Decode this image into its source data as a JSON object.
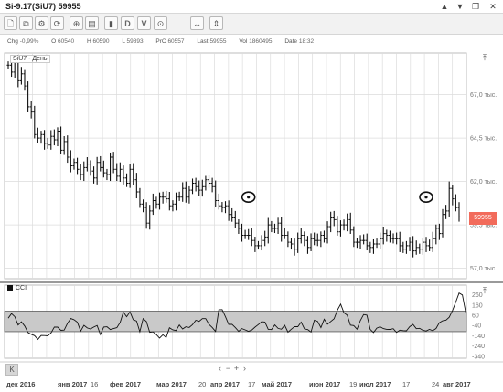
{
  "window": {
    "title": "Si-9.17(SiU7) 59955",
    "controls": [
      "▲",
      "▼",
      "❐",
      "✕"
    ]
  },
  "toolbar": {
    "buttons": [
      {
        "name": "new-doc-icon",
        "glyph": "🗋"
      },
      {
        "name": "copy-icon",
        "glyph": "⧉"
      },
      {
        "name": "gear-icon",
        "glyph": "⚙"
      },
      {
        "name": "refresh-icon",
        "glyph": "⟳"
      },
      {
        "name": "add-indicator-icon",
        "glyph": "⊕"
      },
      {
        "name": "doc-icon",
        "glyph": "▤"
      },
      {
        "name": "candles-icon",
        "glyph": "▮"
      },
      {
        "name": "d-button",
        "glyph": "D"
      },
      {
        "name": "v-button",
        "glyph": "V"
      },
      {
        "name": "target-icon",
        "glyph": "⊙"
      },
      {
        "name": "fit-horizontal-icon",
        "glyph": "↔"
      },
      {
        "name": "fit-vertical-icon",
        "glyph": "⇕"
      }
    ]
  },
  "infobar": {
    "chg_label": "Chg",
    "chg": "-0,99%",
    "open_label": "O",
    "open": "60540",
    "high_label": "H",
    "high": "60590",
    "low_label": "L",
    "low": "59893",
    "prc_label": "PrC",
    "prc": "60557",
    "last_label": "Last",
    "last": "59955",
    "vol_label": "Vol",
    "vol": "1860495",
    "date_label": "Date",
    "date": "18:32"
  },
  "main_legend": "SiU7 - День",
  "cci_legend": "CCI",
  "price_badge": "59955",
  "nav": {
    "left": "‹",
    "minus": "−",
    "plus": "+",
    "right": "›",
    "k": "K"
  },
  "colors": {
    "badge": "#f26b5b",
    "band_fill": "#c9c9c9",
    "grid": "#dcdcdc"
  },
  "chart_data": [
    {
      "type": "ohlc",
      "title": "SiU7 - День",
      "y_ticks": [
        "67,0 тыс.",
        "64,5 тыс.",
        "62,0 тыс.",
        "59,5 тыс.",
        "57,0 тыс."
      ],
      "y_tick_values": [
        67000,
        64500,
        62000,
        59500,
        57000
      ],
      "ylim": [
        56400,
        69400
      ],
      "last_value": 59955,
      "annotations": [
        "circle",
        "circle"
      ],
      "closes": [
        68700,
        68300,
        68900,
        67800,
        68200,
        67500,
        66300,
        66000,
        64700,
        64500,
        64700,
        64200,
        64100,
        64600,
        64400,
        64900,
        63800,
        64300,
        63400,
        62900,
        63100,
        62700,
        62400,
        62800,
        63000,
        62600,
        62200,
        63100,
        62800,
        62500,
        62400,
        63400,
        62700,
        62300,
        62700,
        62200,
        61900,
        62700,
        62100,
        61400,
        60700,
        60500,
        59600,
        60300,
        60900,
        60700,
        61100,
        61100,
        61000,
        60600,
        60700,
        61100,
        61100,
        61600,
        61100,
        61500,
        61900,
        61700,
        61500,
        61700,
        62100,
        61900,
        61700,
        60900,
        60600,
        60500,
        60600,
        60100,
        59900,
        59600,
        59300,
        58900,
        58900,
        58900,
        58600,
        58300,
        58300,
        58600,
        58800,
        59500,
        59300,
        59300,
        59600,
        58900,
        58900,
        58500,
        58400,
        58100,
        58700,
        58900,
        58600,
        58200,
        58700,
        58600,
        58600,
        58900,
        58700,
        59400,
        59900,
        59800,
        59100,
        59500,
        59500,
        59800,
        59200,
        58500,
        58500,
        58600,
        58600,
        58300,
        58200,
        58400,
        58400,
        58700,
        59000,
        58900,
        58700,
        58700,
        58700,
        58300,
        58100,
        58300,
        58500,
        58000,
        58200,
        58100,
        58500,
        58300,
        58200,
        58700,
        59300,
        59000,
        60100,
        60300,
        61600,
        61000,
        60500,
        59955
      ]
    },
    {
      "type": "line",
      "title": "CCI",
      "y_ticks": [
        "260",
        "160",
        "60",
        "-40",
        "-140",
        "-240",
        "-340"
      ],
      "y_tick_values": [
        260,
        160,
        60,
        -40,
        -140,
        -240,
        -340
      ],
      "ylim": [
        -360,
        320
      ],
      "band": [
        -100,
        100
      ],
      "values": [
        32,
        77,
        46,
        -35,
        -4,
        -45,
        -109,
        -126,
        -139,
        -176,
        -137,
        -138,
        -141,
        -112,
        -55,
        -56,
        -87,
        -84,
        -18,
        28,
        17,
        -8,
        -94,
        -38,
        -64,
        -74,
        -55,
        -40,
        -129,
        -55,
        -52,
        -79,
        -70,
        -61,
        -9,
        91,
        46,
        94,
        17,
        4,
        -101,
        27,
        -1,
        -106,
        -102,
        -128,
        -163,
        -130,
        -157,
        -62,
        -83,
        -89,
        -35,
        -74,
        -52,
        -59,
        -32,
        11,
        1,
        27,
        27,
        -29,
        -59,
        -98,
        114,
        116,
        46,
        -29,
        -28,
        -59,
        -96,
        -70,
        -83,
        -96,
        -84,
        -56,
        -31,
        -3,
        -6,
        -77,
        -79,
        -34,
        -68,
        -76,
        -38,
        -105,
        -76,
        -50,
        -51,
        -7,
        -73,
        -80,
        -104,
        11,
        1,
        -60,
        21,
        -27,
        0,
        26,
        110,
        170,
        85,
        61,
        -36,
        -41,
        -76,
        8,
        68,
        61,
        -77,
        -109,
        -66,
        -52,
        -70,
        -77,
        -78,
        -71,
        -108,
        -85,
        -90,
        -92,
        -51,
        -29,
        -71,
        -67,
        -87,
        -93,
        -78,
        -91,
        -69,
        -13,
        7,
        12,
        41,
        107,
        190,
        278,
        259,
        89
      ]
    }
  ],
  "x_axis": {
    "labels": [
      {
        "text": "дек 2016",
        "bold": true
      },
      {
        "text": "янв 2017",
        "bold": true
      },
      {
        "text": "16",
        "bold": false
      },
      {
        "text": "фев 2017",
        "bold": true
      },
      {
        "text": "мар 2017",
        "bold": true
      },
      {
        "text": "20",
        "bold": false
      },
      {
        "text": "апр 2017",
        "bold": true
      },
      {
        "text": "17",
        "bold": false
      },
      {
        "text": "май 2017",
        "bold": true
      },
      {
        "text": "июн 2017",
        "bold": true
      },
      {
        "text": "19",
        "bold": false
      },
      {
        "text": "июл 2017",
        "bold": true
      },
      {
        "text": "17",
        "bold": false
      },
      {
        "text": "24",
        "bold": false
      },
      {
        "text": "авг 2017",
        "bold": true
      }
    ]
  }
}
